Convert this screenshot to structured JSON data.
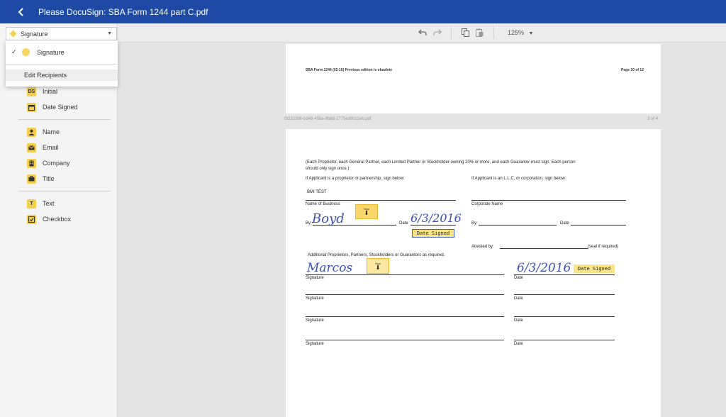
{
  "header": {
    "title": "Please DocuSign: SBA Form 1244 part C.pdf"
  },
  "sidebar": {
    "recipient": "Signature",
    "dropdown": {
      "option": "Signature",
      "edit": "Edit Recipients"
    },
    "fields": [
      {
        "label": "Initial",
        "icon": "DS"
      },
      {
        "label": "Date Signed",
        "icon": "calendar"
      },
      {
        "label": "Name",
        "icon": "person"
      },
      {
        "label": "Email",
        "icon": "envelope"
      },
      {
        "label": "Company",
        "icon": "building"
      },
      {
        "label": "Title",
        "icon": "briefcase"
      },
      {
        "label": "Text",
        "icon": "T"
      },
      {
        "label": "Checkbox",
        "icon": "check"
      }
    ]
  },
  "toolbar": {
    "zoom": "125%"
  },
  "document": {
    "page1": {
      "header_left": "SBA Form 1244 (02-16) Previous edition is obsolete",
      "header_right": "Page 10 of 12"
    },
    "file_id": "fb532398-bd48-458a-9b8d-2775ed9011eb.pdf",
    "page_count": "3 of 4",
    "page2": {
      "intro1": "(Each Proprietor, each General Partner, each Limited Partner or Stockholder owning 20% or more, and each Guarantor must sign. Each person",
      "intro2": "should only sign once.)",
      "left_heading": "If Applicant is a proprietor or partnership, sign below:",
      "right_heading": "If Applicant is an L.L.C. or corporation, sign below:",
      "business_value": "BMI TEST",
      "name_of_business": "Name of Business",
      "corporate_name": "Corporate Name",
      "by": "By:",
      "date": "Date",
      "attested_by": "Attested by:",
      "seal": "(seal if required)",
      "additional": "Additional Proprietors, Partners, Stockholders or Guarantors as required.",
      "signature": "Signature",
      "sign_tag": "Sign",
      "date_signed_tag": "Date Signed",
      "hand_sig1": "Boyd",
      "hand_date1": "6/3/2016",
      "hand_sig2": "Marcos",
      "hand_date2": "6/3/2016"
    }
  }
}
